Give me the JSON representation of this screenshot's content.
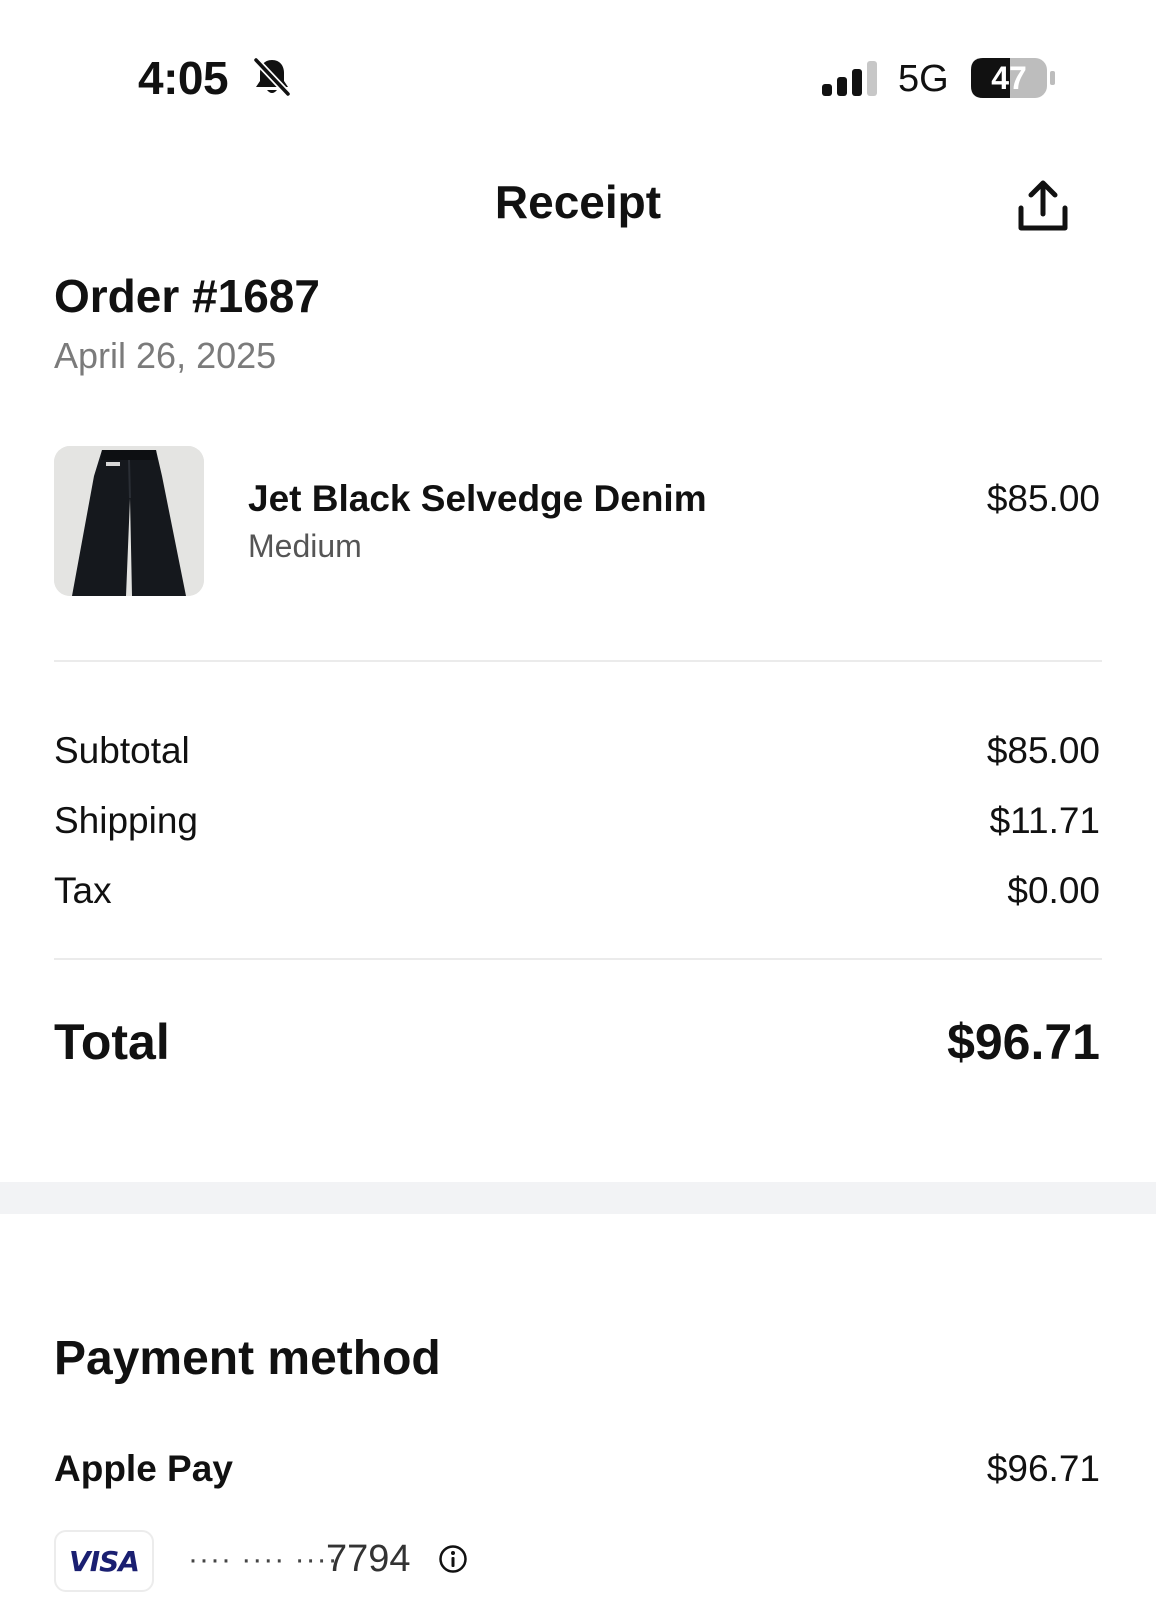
{
  "status_bar": {
    "time": "4:05",
    "network": "5G",
    "battery": "47"
  },
  "header": {
    "title": "Receipt"
  },
  "order": {
    "title": "Order #1687",
    "date": "April 26, 2025"
  },
  "item": {
    "name": "Jet Black Selvedge Denim",
    "variant": "Medium",
    "price": "$85.00"
  },
  "summary": {
    "rows": [
      {
        "label": "Subtotal",
        "value": "$85.00"
      },
      {
        "label": "Shipping",
        "value": "$11.71"
      },
      {
        "label": "Tax",
        "value": "$0.00"
      }
    ],
    "total_label": "Total",
    "total_value": "$96.71"
  },
  "payment": {
    "title": "Payment method",
    "method": "Apple Pay",
    "amount": "$96.71",
    "card_brand": "VISA",
    "card_mask": "···· ···· ····",
    "card_last4": "7794"
  },
  "icons": {
    "silent": "bell-slash-icon",
    "signal": "cellular-signal-icon",
    "battery": "battery-icon",
    "share": "share-icon",
    "info": "info-icon"
  },
  "colors": {
    "text": "#111111",
    "muted": "#7b7b7b",
    "divider": "#ebebeb",
    "band": "#f2f3f5",
    "visa": "#1a1f71"
  }
}
